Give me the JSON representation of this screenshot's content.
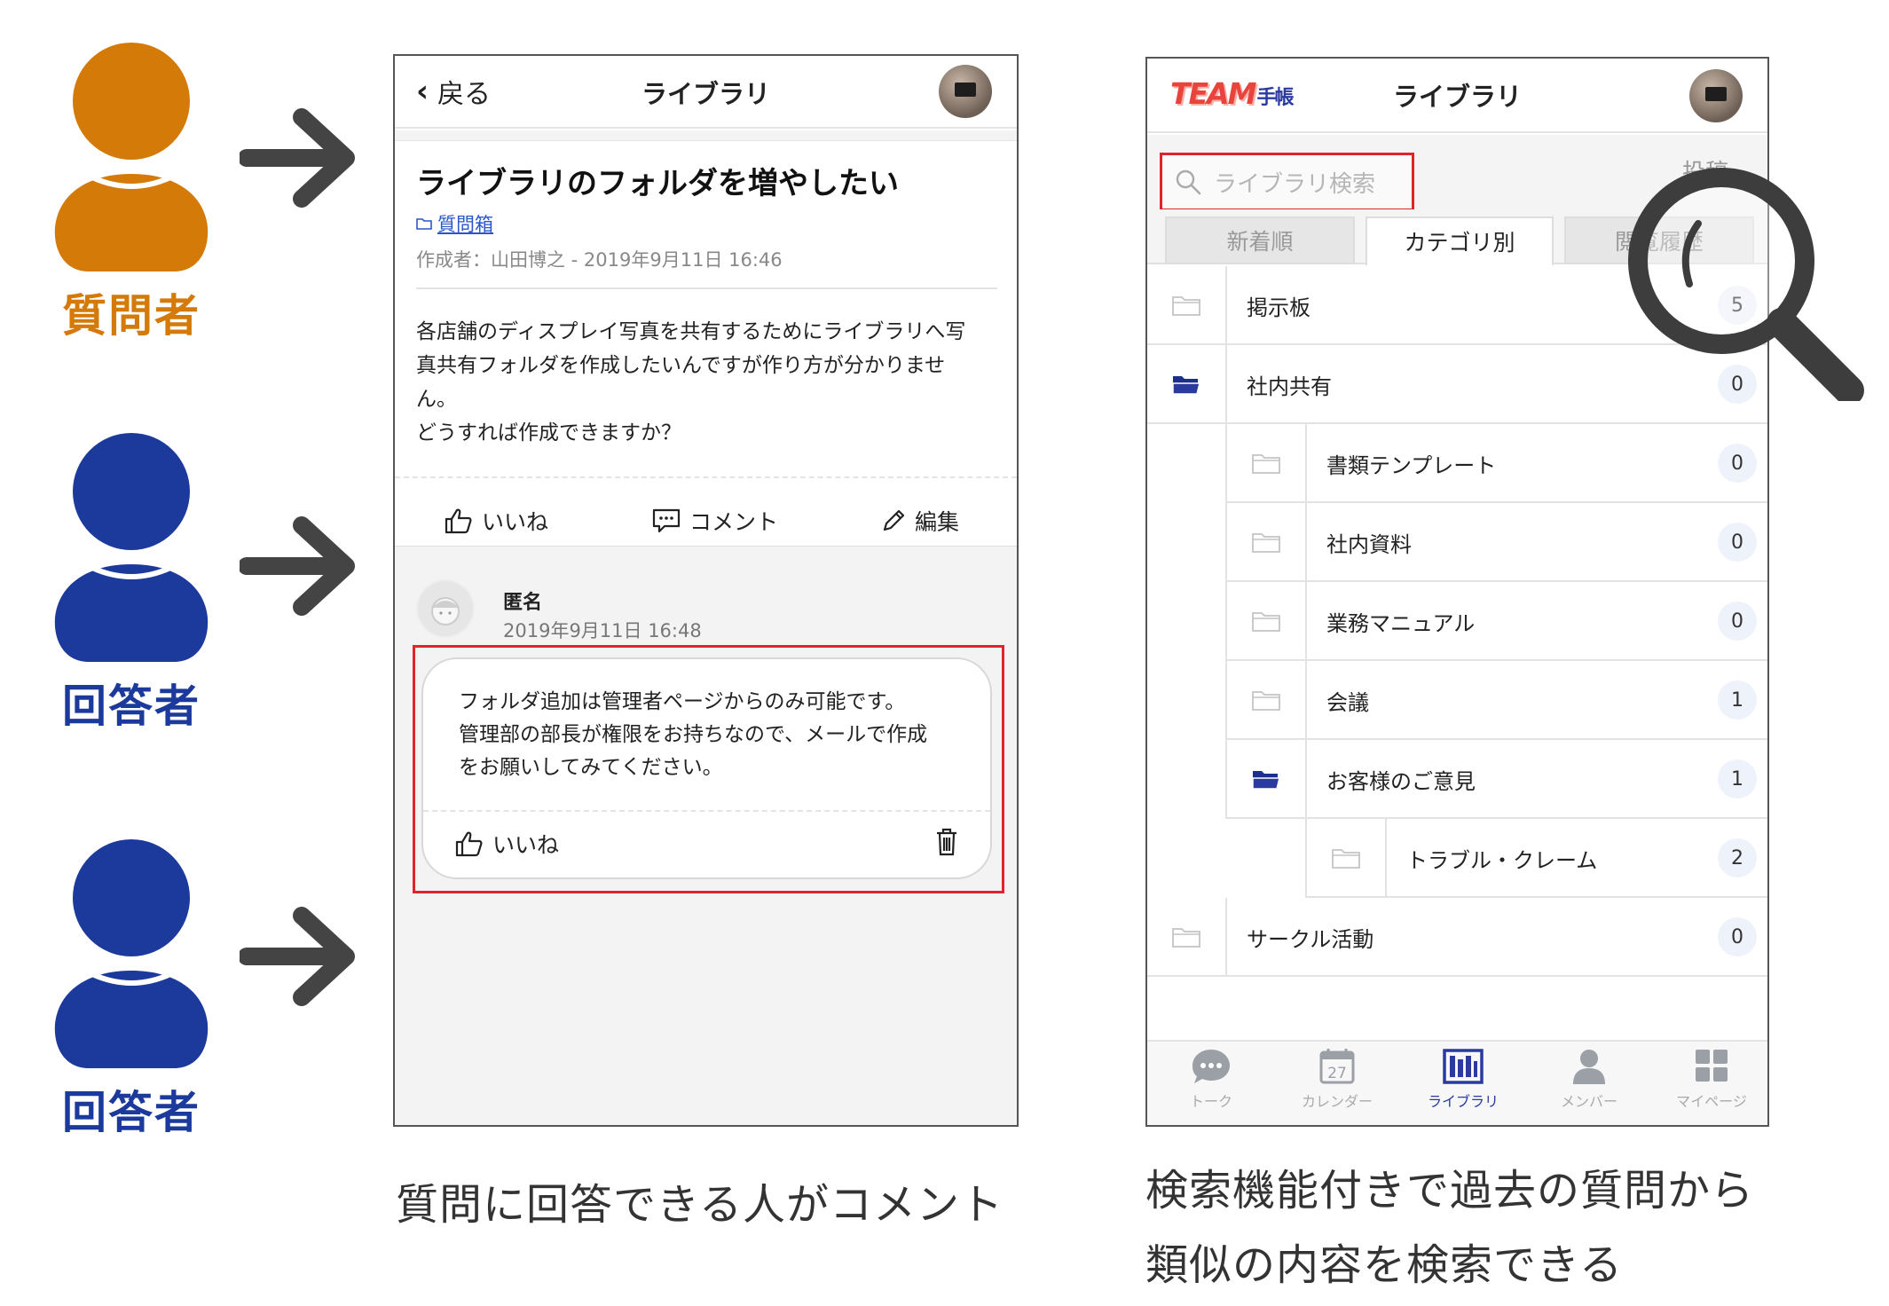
{
  "people": [
    {
      "label": "質問者",
      "color": "#d37a08"
    },
    {
      "label": "回答者",
      "color": "#1c3a9c"
    },
    {
      "label": "回答者",
      "color": "#1c3a9c"
    }
  ],
  "question_screen": {
    "back_label": "戻る",
    "header_title": "ライブラリ",
    "question_title": "ライブラリのフォルダを増やしたい",
    "folder_link": "質問箱",
    "meta": "作成者：山田博之 - 2019年9月11日 16:46",
    "body_lines": [
      "各店舗のディスプレイ写真を共有するためにライブラリへ写",
      "真共有フォルダを作成したいんですが作り方が分かりませ",
      "ん。",
      "どうすれば作成できますか？"
    ],
    "actions": {
      "like": "いいね",
      "comment": "コメント",
      "edit": "編集"
    },
    "answer": {
      "author": "匿名",
      "date": "2019年9月11日 16:48",
      "lines": [
        "フォルダ追加は管理者ページからのみ可能です。",
        "管理部の部長が権限をお持ちなので、メールで作成",
        "をお願いしてみてください。"
      ],
      "like": "いいね"
    }
  },
  "library_screen": {
    "logo_team": "TEAM",
    "logo_techo": "手帳",
    "header_title": "ライブラリ",
    "search_placeholder": "ライブラリ検索",
    "post_label": "投稿",
    "tabs": [
      "新着順",
      "カテゴリ別",
      "閲覧履歴"
    ],
    "items": [
      {
        "name": "掲示板",
        "count": "5",
        "level": 0,
        "open": false
      },
      {
        "name": "社内共有",
        "count": "0",
        "level": 0,
        "open": true
      },
      {
        "name": "書類テンプレート",
        "count": "0",
        "level": 1,
        "open": false
      },
      {
        "name": "社内資料",
        "count": "0",
        "level": 1,
        "open": false
      },
      {
        "name": "業務マニュアル",
        "count": "0",
        "level": 1,
        "open": false
      },
      {
        "name": "会議",
        "count": "1",
        "level": 1,
        "open": false
      },
      {
        "name": "お客様のご意見",
        "count": "1",
        "level": 1,
        "open": true
      },
      {
        "name": "トラブル・クレーム",
        "count": "2",
        "level": 2,
        "open": false
      },
      {
        "name": "サークル活動",
        "count": "0",
        "level": 0,
        "open": false
      }
    ],
    "nav": [
      "トーク",
      "カレンダー",
      "ライブラリ",
      "メンバー",
      "マイページ"
    ],
    "calendar_day": "27"
  },
  "captions": {
    "left": "質問に回答できる人がコメント",
    "right_line1": "検索機能付きで過去の質問から",
    "right_line2": "類似の内容を検索できる"
  },
  "colors": {
    "questioner": "#d37a08",
    "answerer": "#1c3a9c",
    "highlight": "#e0242b",
    "accent_blue": "#2a3aa0"
  }
}
